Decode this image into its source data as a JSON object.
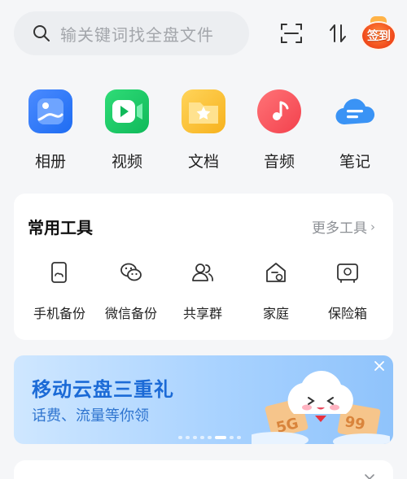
{
  "search": {
    "placeholder": "输关键词找全盘文件",
    "icon": "search-icon"
  },
  "header": {
    "scan_icon": "scan-icon",
    "sort_icon": "sort-icon",
    "sign_in_label": "签到",
    "sign_in_color": "#f0481a"
  },
  "categories": [
    {
      "label": "相册",
      "icon": "photo-album-icon",
      "color": "#1e6cf2"
    },
    {
      "label": "视频",
      "icon": "video-icon",
      "color": "#10b95a"
    },
    {
      "label": "文档",
      "icon": "document-folder-icon",
      "color": "#f7b21e"
    },
    {
      "label": "音频",
      "icon": "music-note-icon",
      "color": "#f3414d"
    },
    {
      "label": "笔记",
      "icon": "note-cloud-icon",
      "color": "#2d8cf0"
    }
  ],
  "tools": {
    "title": "常用工具",
    "more": "更多工具",
    "items": [
      {
        "label": "手机备份",
        "icon": "phone-backup-icon"
      },
      {
        "label": "微信备份",
        "icon": "wechat-icon"
      },
      {
        "label": "共享群",
        "icon": "group-icon"
      },
      {
        "label": "家庭",
        "icon": "home-icon"
      },
      {
        "label": "保险箱",
        "icon": "safe-icon"
      }
    ]
  },
  "banner": {
    "headline": "移动云盘三重礼",
    "subline": "话费、流量等你领",
    "coupon_5g": "5G",
    "coupon_99": "99",
    "accent": "#1b6ad6"
  }
}
